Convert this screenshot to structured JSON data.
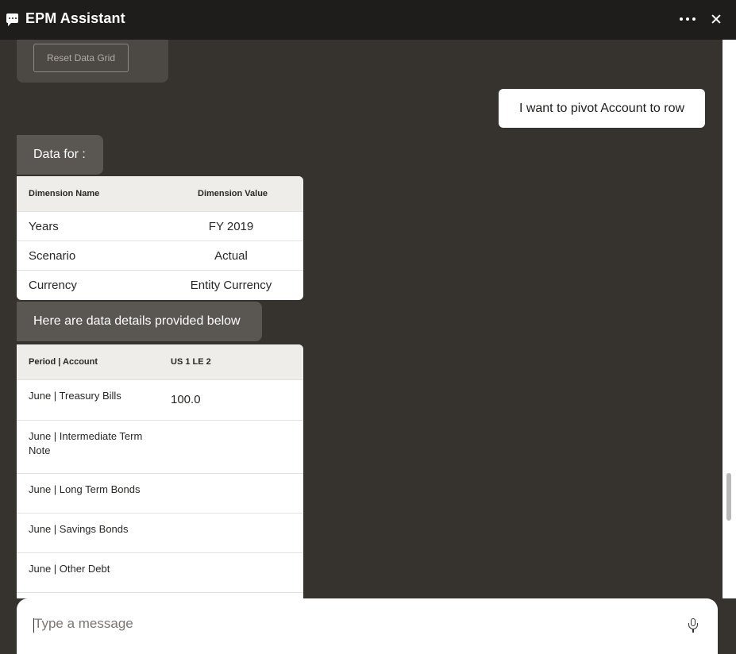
{
  "window": {
    "title": "EPM Assistant"
  },
  "chat": {
    "reset_button_label": "Reset Data Grid",
    "user_message": "I want to pivot Account to row",
    "bot_message_1": "Data for :",
    "dimension_table": {
      "headers": [
        "Dimension Name",
        "Dimension Value"
      ],
      "rows": [
        [
          "Years",
          "FY 2019"
        ],
        [
          "Scenario",
          "Actual"
        ],
        [
          "Currency",
          "Entity Currency"
        ]
      ]
    },
    "bot_message_2": "Here are data details provided below",
    "data_table": {
      "headers": [
        "Period | Account",
        "US 1 LE 2"
      ],
      "rows": [
        [
          "June | Treasury Bills",
          "100.0"
        ],
        [
          "June | Intermediate Term Note",
          ""
        ],
        [
          "June | Long Term Bonds",
          ""
        ],
        [
          "June | Savings Bonds",
          ""
        ],
        [
          "June | Other Debt",
          ""
        ]
      ]
    }
  },
  "composer": {
    "placeholder": "Type a message"
  }
}
